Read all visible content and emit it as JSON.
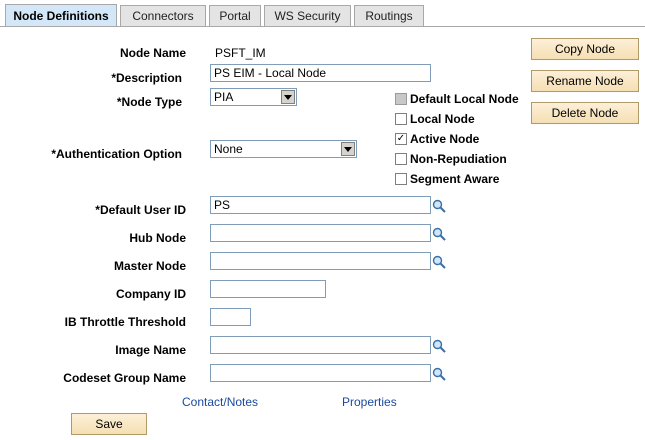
{
  "tabs": [
    {
      "label": "Node Definitions",
      "active": true
    },
    {
      "label": "Connectors"
    },
    {
      "label": "Portal"
    },
    {
      "label": "WS Security"
    },
    {
      "label": "Routings"
    }
  ],
  "form": {
    "node_name_label": "Node Name",
    "node_name_value": "PSFT_IM",
    "description_label": "*Description",
    "description_value": "PS EIM - Local Node",
    "node_type_label": "*Node Type",
    "node_type_value": "PIA",
    "auth_label": "*Authentication Option",
    "auth_value": "None",
    "default_user_label": "*Default User ID",
    "default_user_value": "PS",
    "hub_node_label": "Hub Node",
    "hub_node_value": "",
    "master_node_label": "Master Node",
    "master_node_value": "",
    "company_id_label": "Company ID",
    "company_id_value": "",
    "ib_throttle_label": "IB Throttle Threshold",
    "ib_throttle_value": "",
    "image_name_label": "Image Name",
    "image_name_value": "",
    "codeset_label": "Codeset Group Name",
    "codeset_value": ""
  },
  "checkboxes": [
    {
      "label": "Default Local Node",
      "checked": false,
      "disabled": true
    },
    {
      "label": "Local Node",
      "checked": false,
      "disabled": false
    },
    {
      "label": "Active Node",
      "checked": true,
      "disabled": false
    },
    {
      "label": "Non-Repudiation",
      "checked": false,
      "disabled": false
    },
    {
      "label": "Segment Aware",
      "checked": false,
      "disabled": false
    }
  ],
  "buttons": {
    "copy": "Copy Node",
    "rename": "Rename Node",
    "delete": "Delete Node",
    "save": "Save"
  },
  "links": {
    "contact": "Contact/Notes",
    "properties": "Properties"
  },
  "icons": {
    "lookup": "magnifier-icon",
    "dropdown": "dropdown-arrow-icon",
    "checkmark": "✓"
  },
  "colors": {
    "active_tab": "#d4e7f8",
    "button_bg": "#f5dfb3",
    "link": "#1a4aa0",
    "input_border": "#7f9db9"
  }
}
